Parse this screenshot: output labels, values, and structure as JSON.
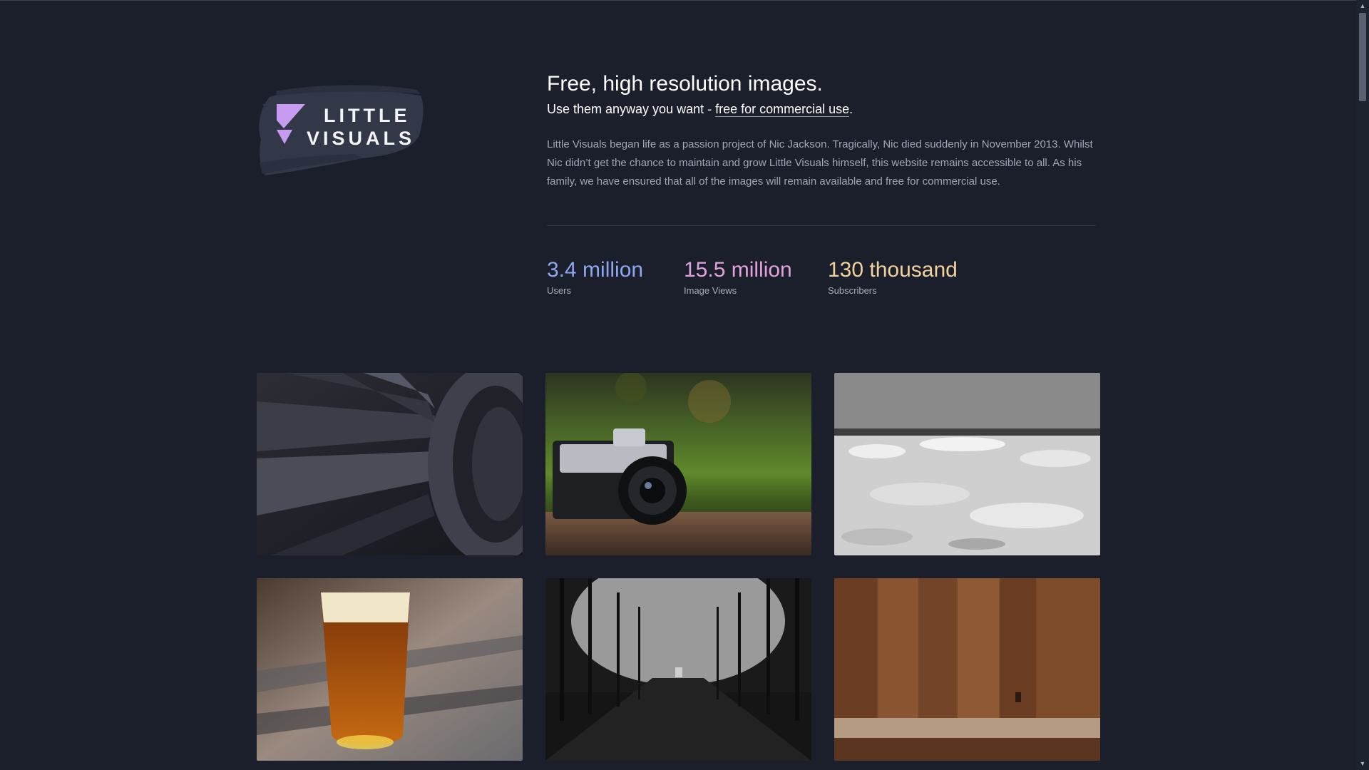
{
  "brand": {
    "logo_line1": "LITTLE",
    "logo_line2": "VISUALS",
    "accent_color": "#c79cf0",
    "brush_color": "#323848"
  },
  "hero": {
    "headline": "Free, high resolution images.",
    "subline_prefix": "Use them anyway you want - ",
    "subline_link": "free for commercial use",
    "subline_suffix": ".",
    "description": "Little Visuals began life as a passion project of Nic Jackson. Tragically, Nic died suddenly in November 2013. Whilst Nic didn’t get the chance to maintain and grow Little Visuals himself, this website remains accessible to all. As his family, we have ensured that all of the images will remain available and free for commercial use."
  },
  "stats": [
    {
      "value": "3.4 million",
      "label": "Users",
      "color": "#8ea8f0"
    },
    {
      "value": "15.5 million",
      "label": "Image Views",
      "color": "#e2a3dc"
    },
    {
      "value": "130 thousand",
      "label": "Subscribers",
      "color": "#f2d29b"
    }
  ],
  "gallery": [
    {
      "name": "turbine-photo"
    },
    {
      "name": "camera-photo"
    },
    {
      "name": "icy-beach-photo"
    },
    {
      "name": "beer-glass-photo"
    },
    {
      "name": "tree-avenue-photo"
    },
    {
      "name": "wooden-planks-photo"
    }
  ],
  "scrollbar": {
    "up_icon": "triangle-up",
    "down_icon": "triangle-down"
  }
}
